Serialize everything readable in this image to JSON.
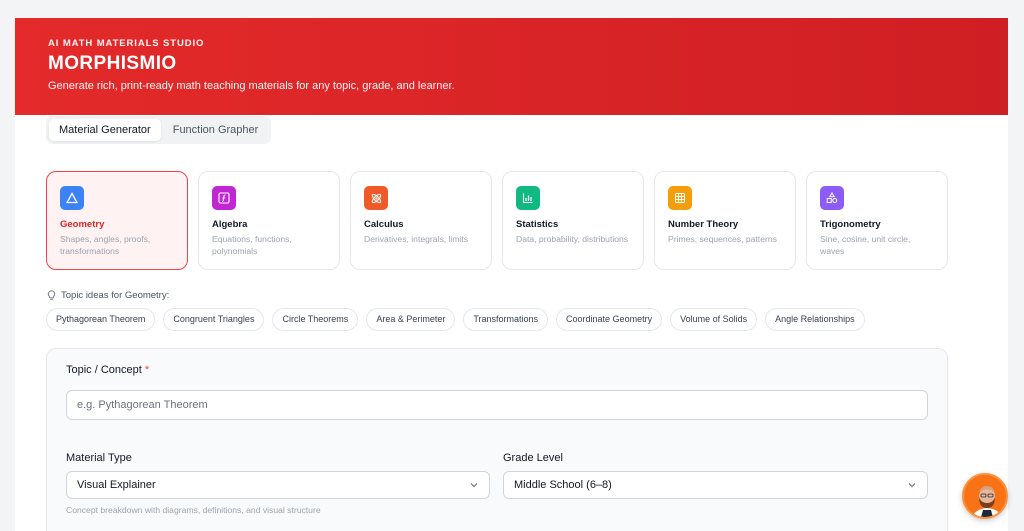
{
  "header": {
    "eyebrow": "AI MATH MATERIALS STUDIO",
    "brand": "MORPHISMIO",
    "tagline": "Generate rich, print-ready math teaching materials for any topic, grade, and learner."
  },
  "tabs": [
    {
      "label": "Material Generator",
      "active": true
    },
    {
      "label": "Function Grapher",
      "active": false
    }
  ],
  "categories": [
    {
      "name": "Geometry",
      "desc": "Shapes, angles, proofs, transformations",
      "color": "#3b82f6",
      "icon": "triangle-icon",
      "selected": true
    },
    {
      "name": "Algebra",
      "desc": "Equations, functions, polynomials",
      "color": "#c026d3",
      "icon": "function-icon",
      "selected": false
    },
    {
      "name": "Calculus",
      "desc": "Derivatives, integrals, limits",
      "color": "#f05a28",
      "icon": "atom-icon",
      "selected": false
    },
    {
      "name": "Statistics",
      "desc": "Data, probability, distributions",
      "color": "#10b981",
      "icon": "bar-chart-icon",
      "selected": false
    },
    {
      "name": "Number Theory",
      "desc": "Primes, sequences, patterns",
      "color": "#f59e0b",
      "icon": "grid-icon",
      "selected": false
    },
    {
      "name": "Trigonometry",
      "desc": "Sine, cosine, unit circle, waves",
      "color": "#8b5cf6",
      "icon": "shapes-icon",
      "selected": false
    }
  ],
  "ideas": {
    "label": "Topic ideas for Geometry:",
    "chips": [
      "Pythagorean Theorem",
      "Congruent Triangles",
      "Circle Theorems",
      "Area & Perimeter",
      "Transformations",
      "Coordinate Geometry",
      "Volume of Solids",
      "Angle Relationships"
    ]
  },
  "form": {
    "topic_label": "Topic / Concept",
    "required_mark": "*",
    "topic_placeholder": "e.g. Pythagorean Theorem",
    "material_label": "Material Type",
    "material_value": "Visual Explainer",
    "grade_label": "Grade Level",
    "grade_value": "Middle School (6–8)",
    "material_hint": "Concept breakdown with diagrams, definitions, and visual structure"
  }
}
